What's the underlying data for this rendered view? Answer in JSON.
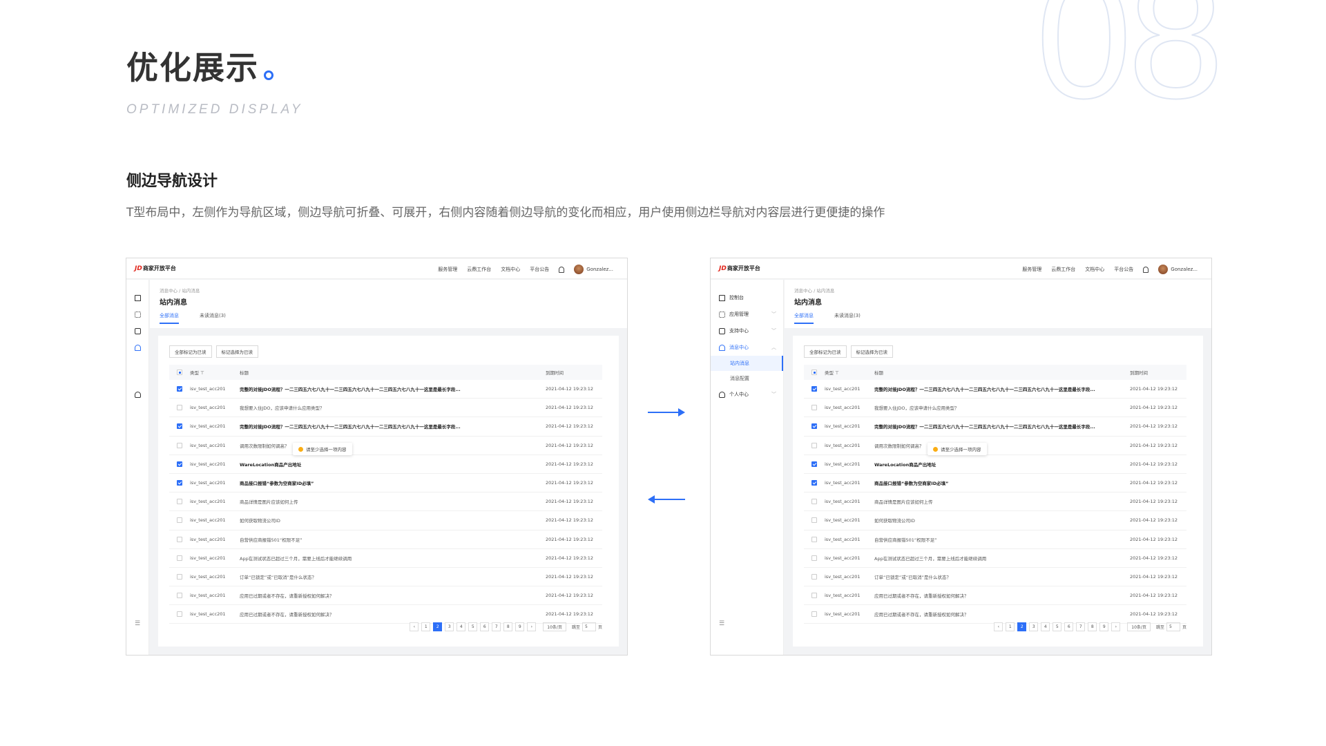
{
  "hero": {
    "title": "优化展示",
    "subtitle": "OPTIMIZED DISPLAY",
    "number": "08"
  },
  "section": {
    "title": "侧边导航设计",
    "desc": "T型布局中，左侧作为导航区域，侧边导航可折叠、可展开，右侧内容随着侧边导航的变化而相应，用户使用侧边栏导航对内容层进行更便捷的操作"
  },
  "app": {
    "logo_brand": "JD",
    "logo_text": "商家开放平台",
    "top_menu": [
      "服务管理",
      "云鼎工作台",
      "文档中心",
      "平台公告"
    ],
    "user_name": "Gonzalez...",
    "breadcrumb": "消息中心  /  站内消息",
    "page_title": "站内消息",
    "tabs": [
      "全部消息",
      "未读消息(3)"
    ],
    "buttons": [
      "全部标记为已读",
      "标记选择为已读"
    ],
    "columns": {
      "type": "类型 ⊤",
      "title": "标题",
      "time": "到期时间"
    },
    "sidebar_expanded": {
      "items": [
        "控制台",
        "应用管理",
        "支持中心",
        "消息中心"
      ],
      "subitems": [
        "站内消息",
        "消息配置"
      ],
      "personal": "个人中心"
    },
    "rows": [
      {
        "type": "isv_test_acc201",
        "title": "完整的对接JDO流程？一二三四五六七八九十一二三四五六七八九十一二三四五六七八九十一这里是最长字段...",
        "time": "2021-04-12 19:23:12",
        "checked": true,
        "bold": true
      },
      {
        "type": "isv_test_acc201",
        "title": "我想要入住JDO，应该申请什么应用类型？",
        "time": "2021-04-12 19:23:12",
        "checked": false,
        "bold": false
      },
      {
        "type": "isv_test_acc201",
        "title": "完整的对接JDO流程？一二三四五六七八九十一二三四五六七八九十一二三四五六七八九十一这里是最长字段...",
        "time": "2021-04-12 19:23:12",
        "checked": true,
        "bold": true
      },
      {
        "type": "isv_test_acc201",
        "title": "调用次数限制如何调高？",
        "time": "2021-04-12 19:23:12",
        "checked": false,
        "bold": false
      },
      {
        "type": "isv_test_acc201",
        "title": "WareLocation商品产出地址",
        "time": "2021-04-12 19:23:12",
        "checked": true,
        "bold": true
      },
      {
        "type": "isv_test_acc201",
        "title": "商品接口报错“参数为空商家ID必填”",
        "time": "2021-04-12 19:23:12",
        "checked": true,
        "bold": true
      },
      {
        "type": "isv_test_acc201",
        "title": "商品详情是图片应该如何上传",
        "time": "2021-04-12 19:23:12",
        "checked": false,
        "bold": false
      },
      {
        "type": "isv_test_acc201",
        "title": "如何获取物流公司ID",
        "time": "2021-04-12 19:23:12",
        "checked": false,
        "bold": false
      },
      {
        "type": "isv_test_acc201",
        "title": "自营供应商报错501“权限不足”",
        "time": "2021-04-12 19:23:12",
        "checked": false,
        "bold": false
      },
      {
        "type": "isv_test_acc201",
        "title": "App在测试状态已超过三个月，需要上线后才能继续调用",
        "time": "2021-04-12 19:23:12",
        "checked": false,
        "bold": false
      },
      {
        "type": "isv_test_acc201",
        "title": "订单“已锁定”或“已取消”是什么状态？",
        "time": "2021-04-12 19:23:12",
        "checked": false,
        "bold": false
      },
      {
        "type": "isv_test_acc201",
        "title": "应用已过期或者不存在，请重新授权如何解决？",
        "time": "2021-04-12 19:23:12",
        "checked": false,
        "bold": false
      },
      {
        "type": "isv_test_acc201",
        "title": "应用已过期或者不存在，请重新授权如何解决？",
        "time": "2021-04-12 19:23:12",
        "checked": false,
        "bold": false
      }
    ],
    "tooltip": "请至少选择一项内容",
    "pagination": {
      "pages": [
        "1",
        "2",
        "3",
        "4",
        "5",
        "6",
        "7",
        "8",
        "9"
      ],
      "active": "2",
      "page_size": "10条/页",
      "jump_label": "跳至",
      "jump_value": "5",
      "page_unit": "页"
    }
  }
}
